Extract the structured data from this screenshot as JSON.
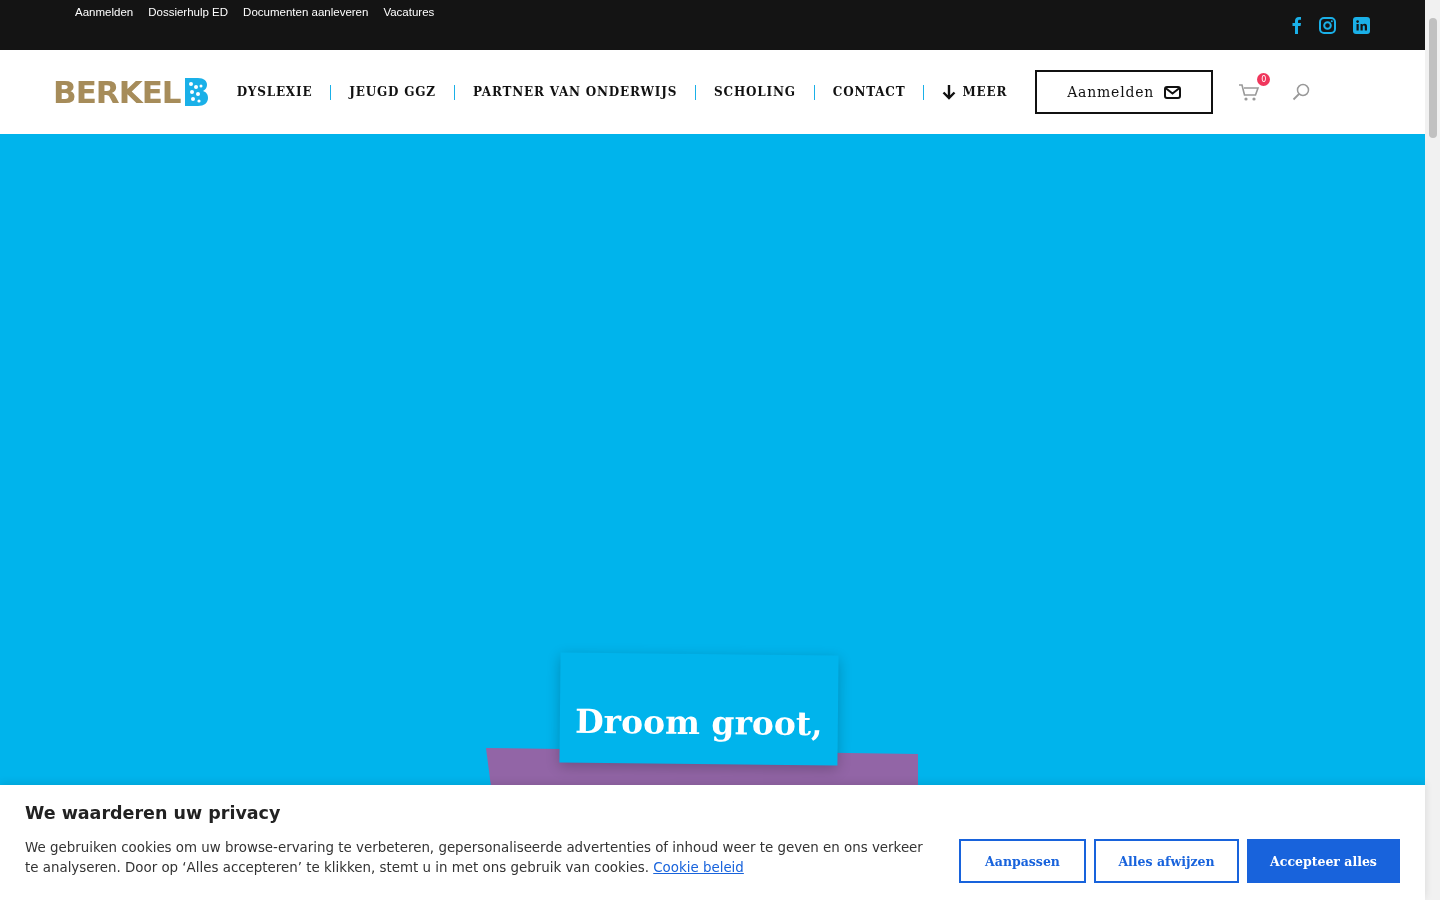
{
  "top_bar": {
    "links": [
      "Aanmelden",
      "Dossierhulp ED",
      "Documenten aanleveren",
      "Vacatures"
    ]
  },
  "header": {
    "logo": "BERKEL",
    "nav": [
      {
        "label": "DYSLEXIE",
        "kind": "plain"
      },
      {
        "label": "JEUGD GGZ",
        "kind": "plain"
      },
      {
        "label": "PARTNER VAN ONDERWIJS",
        "kind": "plain"
      },
      {
        "label": "SCHOLING",
        "kind": "plain"
      },
      {
        "label": "CONTACT",
        "kind": "plain"
      },
      {
        "label": "MEER",
        "kind": "more"
      }
    ],
    "cta": "Aanmelden",
    "cart_count": "0"
  },
  "hero": {
    "headline": "Droom groot,"
  },
  "cookie_banner": {
    "title": "We waarderen uw privacy",
    "text": "We gebruiken cookies om uw browse-ervaring te verbeteren, gepersonaliseerde advertenties of inhoud weer te geven en ons verkeer te analyseren. Door op ‘Alles accepteren’ te klikken, stemt u in met ons gebruik van cookies.",
    "link": "Cookie beleid",
    "buttons": [
      {
        "label": "Aanpassen",
        "kind": "outline"
      },
      {
        "label": "Alles afwijzen",
        "kind": "outline"
      },
      {
        "label": "Accepteer alles",
        "kind": "primary"
      }
    ]
  }
}
